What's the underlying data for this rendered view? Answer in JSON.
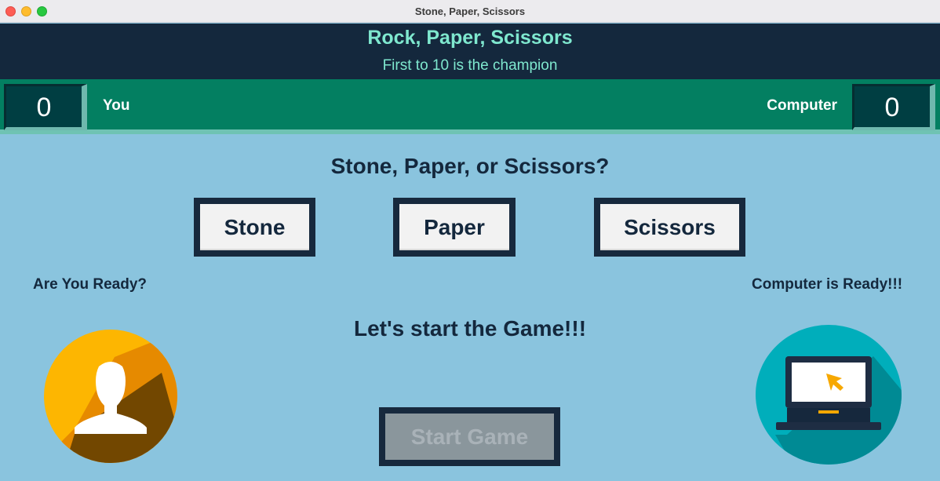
{
  "window": {
    "title": "Stone, Paper, Scissors"
  },
  "header": {
    "title": "Rock, Paper, Scissors",
    "subtitle": "First to 10 is the champion"
  },
  "scoreboard": {
    "player_label": "You",
    "player_score": "0",
    "computer_label": "Computer",
    "computer_score": "0"
  },
  "game": {
    "question": "Stone, Paper, or Scissors?",
    "choices": {
      "stone": "Stone",
      "paper": "Paper",
      "scissors": "Scissors"
    },
    "player_status": "Are You Ready?",
    "computer_status": "Computer is Ready!!!",
    "message": "Let's start the Game!!!",
    "start_button": "Start Game"
  },
  "icons": {
    "player_avatar": "user-icon",
    "computer_avatar": "laptop-icon"
  },
  "colors": {
    "header_bg": "#14283d",
    "accent_text": "#7fe8cf",
    "scorebar_bg": "#037f61",
    "score_box_bg": "#003e42",
    "main_bg": "#8ac4de",
    "button_border": "#17293d"
  }
}
